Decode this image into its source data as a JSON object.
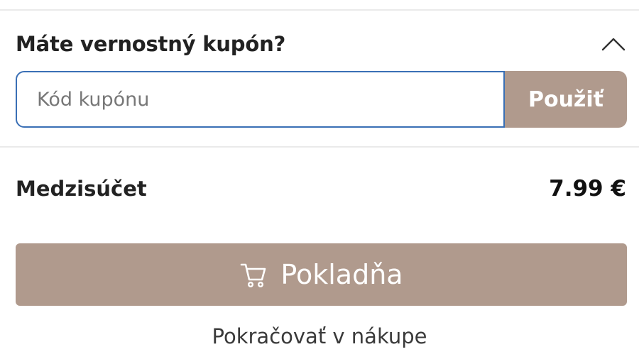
{
  "coupon": {
    "title": "Máte vernostný kupón?",
    "toggle_icon": "chevron-up-icon",
    "input_value": "",
    "input_placeholder": "Kód kupónu",
    "apply_label": "Použiť"
  },
  "summary": {
    "subtotal_label": "Medzisúčet",
    "subtotal_value": "7.99 €"
  },
  "checkout": {
    "icon": "cart-icon",
    "label": "Pokladňa"
  },
  "continue_label": "Pokračovať v nákupe",
  "colors": {
    "accent": "#b09a8d",
    "input_border": "#3a6fb5"
  }
}
